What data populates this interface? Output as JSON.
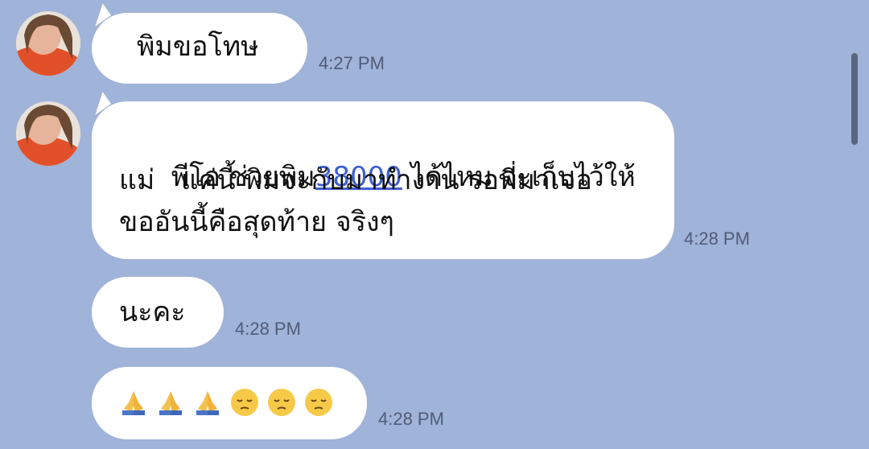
{
  "messages": [
    {
      "text": "พิมขอโทษ",
      "time": "4:27 PM"
    },
    {
      "line1_prefix": "พีโอ ช่วยพิม",
      "line1_link": "38000",
      "line1_suffix": " ได้ไหม จะเก็บไว้ให้",
      "line2": "แม่   แค่นี้ พิมจะกับมาทำงาน รอพี่มาเจอ",
      "line3": "ขออันนี้คือสุดท้าย จริงๆ",
      "time": "4:28 PM"
    },
    {
      "text": "นะคะ",
      "time": "4:28 PM"
    },
    {
      "emoji_names": [
        "folded-hands-icon",
        "folded-hands-icon",
        "folded-hands-icon",
        "pensive-face-icon",
        "pensive-face-icon",
        "pensive-face-icon"
      ],
      "time": "4:28 PM"
    }
  ],
  "colors": {
    "background": "#a0b3d9",
    "bubble": "#ffffff",
    "link": "#3d5fd0"
  }
}
